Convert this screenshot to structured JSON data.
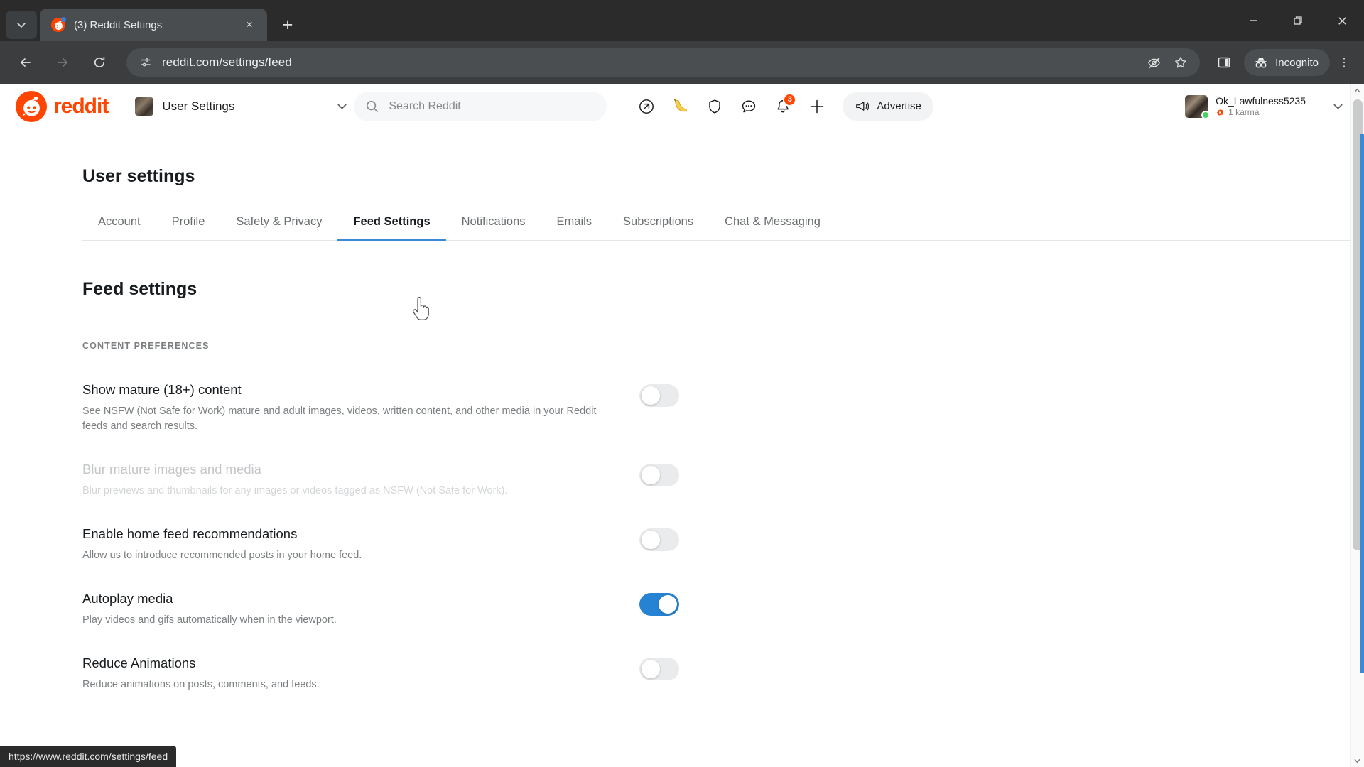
{
  "browser": {
    "tab": {
      "title": "(3) Reddit Settings",
      "favicon": "reddit-favicon",
      "close_label": "×"
    },
    "new_tab_label": "+",
    "tab_search_label": "⌄",
    "window_controls": {
      "minimize": "—",
      "maximize": "❐",
      "close": "✕"
    },
    "nav": {
      "back": "←",
      "forward": "→",
      "reload": "↻"
    },
    "omnibox": {
      "url": "reddit.com/settings/feed",
      "page_info_icon": "page-settings-icon"
    },
    "omnibox_icons": [
      "tracking-protection-off-icon",
      "bookmark-star-icon"
    ],
    "toolbar_icons": [
      "side-panel-icon"
    ],
    "incognito": {
      "label": "Incognito",
      "icon": "incognito-icon"
    },
    "menu_label": "⋮",
    "status_bar": {
      "url": "https://www.reddit.com/settings/feed"
    }
  },
  "reddit_nav": {
    "logo_text": "reddit",
    "selector": {
      "label": "User Settings",
      "chevron": "⌄"
    },
    "search": {
      "placeholder": "Search Reddit",
      "value": "",
      "icon": "search-icon"
    },
    "icons": [
      {
        "name": "popular-arrow-icon",
        "glyph": "↗"
      },
      {
        "name": "banana-icon",
        "glyph": "🍌"
      },
      {
        "name": "shield-icon",
        "glyph": "shield"
      },
      {
        "name": "chat-icon",
        "glyph": "chat"
      },
      {
        "name": "notifications-bell-icon",
        "glyph": "bell",
        "badge": "3"
      },
      {
        "name": "create-post-plus-icon",
        "glyph": "+"
      }
    ],
    "advertise": {
      "label": "Advertise",
      "icon": "megaphone-icon"
    },
    "user": {
      "name": "Ok_Lawfulness5235",
      "karma": "1 karma",
      "karma_icon": "karma-icon",
      "chevron": "⌄",
      "online": true
    }
  },
  "settings": {
    "page_title": "User settings",
    "tabs": [
      {
        "label": "Account",
        "active": false
      },
      {
        "label": "Profile",
        "active": false
      },
      {
        "label": "Safety & Privacy",
        "active": false
      },
      {
        "label": "Feed Settings",
        "active": true
      },
      {
        "label": "Notifications",
        "active": false
      },
      {
        "label": "Emails",
        "active": false
      },
      {
        "label": "Subscriptions",
        "active": false
      },
      {
        "label": "Chat & Messaging",
        "active": false
      }
    ],
    "section_title": "Feed settings",
    "group_header": "CONTENT PREFERENCES",
    "preferences": [
      {
        "title": "Show mature (18+) content",
        "description": "See NSFW (Not Safe for Work) mature and adult images, videos, written content, and other media in your Reddit feeds and search results.",
        "enabled": false,
        "disabled": false
      },
      {
        "title": "Blur mature images and media",
        "description": "Blur previews and thumbnails for any images or videos tagged as NSFW (Not Safe for Work).",
        "enabled": false,
        "disabled": true
      },
      {
        "title": "Enable home feed recommendations",
        "description": "Allow us to introduce recommended posts in your home feed.",
        "enabled": false,
        "disabled": false
      },
      {
        "title": "Autoplay media",
        "description": "Play videos and gifs automatically when in the viewport.",
        "enabled": true,
        "disabled": false
      },
      {
        "title": "Reduce Animations",
        "description": "Reduce animations on posts, comments, and feeds.",
        "enabled": false,
        "disabled": false
      }
    ]
  },
  "colors": {
    "brand": "#ff4500",
    "accent_blue": "#2683d4",
    "tab_underline": "#3a8ad8",
    "badge": "#ff4500",
    "online": "#46d160"
  }
}
